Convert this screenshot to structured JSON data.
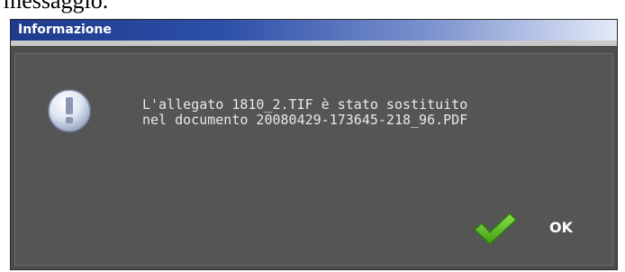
{
  "page_caption": "messaggio.",
  "dialog": {
    "title": "Informazione",
    "message_line_1": "L'allegato 1810_2.TIF è stato sostituito",
    "message_line_2": "nel documento 20080429-173645-218_96.PDF",
    "icon": "info-exclamation-icon",
    "ok_label": "OK",
    "ok_icon": "checkmark-icon"
  },
  "colors": {
    "dialog_background": "#4d4d4d",
    "title_gradient_start": "#1e3a8c",
    "title_gradient_end": "#e4ebf7",
    "check_green": "#58c322"
  }
}
